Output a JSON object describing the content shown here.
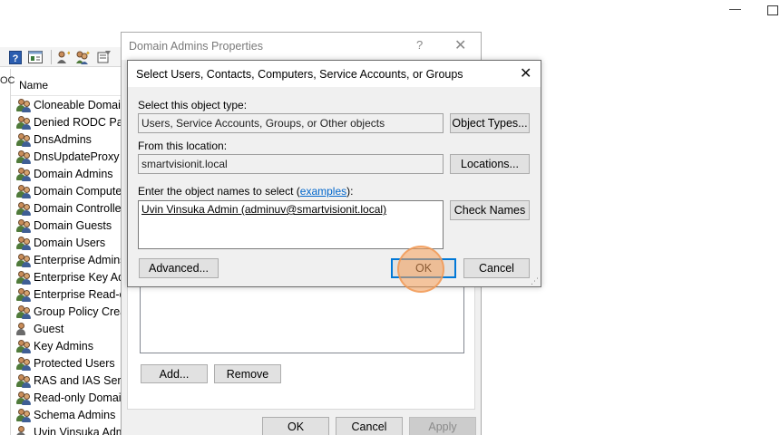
{
  "window_controls": {
    "minimize": "—",
    "maximize": ""
  },
  "toolbar": {
    "icons": [
      "help-icon",
      "console-icon",
      "new-user-icon",
      "new-group-icon",
      "filter-icon"
    ]
  },
  "tree_edge_text": "OC",
  "list": {
    "header": "Name",
    "items": [
      {
        "label": "Cloneable Domain",
        "icon": "group-icon"
      },
      {
        "label": "Denied RODC Pass",
        "icon": "group-icon"
      },
      {
        "label": "DnsAdmins",
        "icon": "group-icon"
      },
      {
        "label": "DnsUpdateProxy",
        "icon": "group-icon"
      },
      {
        "label": "Domain Admins",
        "icon": "group-icon",
        "selected": true
      },
      {
        "label": "Domain Compute",
        "icon": "group-icon"
      },
      {
        "label": "Domain Controller",
        "icon": "group-icon"
      },
      {
        "label": "Domain Guests",
        "icon": "group-icon"
      },
      {
        "label": "Domain Users",
        "icon": "group-icon"
      },
      {
        "label": "Enterprise Admins",
        "icon": "group-icon"
      },
      {
        "label": "Enterprise Key Adr",
        "icon": "group-icon"
      },
      {
        "label": "Enterprise Read-or",
        "icon": "group-icon"
      },
      {
        "label": "Group Policy Creat",
        "icon": "group-icon"
      },
      {
        "label": "Guest",
        "icon": "user-icon"
      },
      {
        "label": "Key Admins",
        "icon": "group-icon"
      },
      {
        "label": "Protected Users",
        "icon": "group-icon"
      },
      {
        "label": "RAS and IAS Serve",
        "icon": "group-icon"
      },
      {
        "label": "Read-only Domair",
        "icon": "group-icon"
      },
      {
        "label": "Schema Admins",
        "icon": "group-icon"
      },
      {
        "label": "Uvin Vinsuka Adm",
        "icon": "user-icon"
      }
    ]
  },
  "properties_dialog": {
    "title": "Domain Admins Properties",
    "help": "?",
    "close": "✕",
    "add_label": "Add...",
    "remove_label": "Remove",
    "ok_label": "OK",
    "cancel_label": "Cancel",
    "apply_label": "Apply"
  },
  "select_dialog": {
    "title": "Select Users, Contacts, Computers, Service Accounts, or Groups",
    "close": "✕",
    "object_type_label": "Select this object type:",
    "object_type_value": "Users, Service Accounts, Groups, or Other objects",
    "object_types_button": "Object Types...",
    "location_label": "From this location:",
    "location_value": "smartvisionit.local",
    "locations_button": "Locations...",
    "names_label_prefix": "Enter the object names to select (",
    "names_label_link": "examples",
    "names_label_suffix": "):",
    "names_value": "Uvin Vinsuka Admin (adminuv@smartvisionit.local)",
    "check_names_button": "Check Names",
    "advanced_button": "Advanced...",
    "ok_button": "OK",
    "cancel_button": "Cancel",
    "grip": "⋰"
  },
  "colors": {
    "accent": "#0078d7",
    "click_highlight": "#f7a05a",
    "dialog_bg": "#f0f0f0"
  }
}
